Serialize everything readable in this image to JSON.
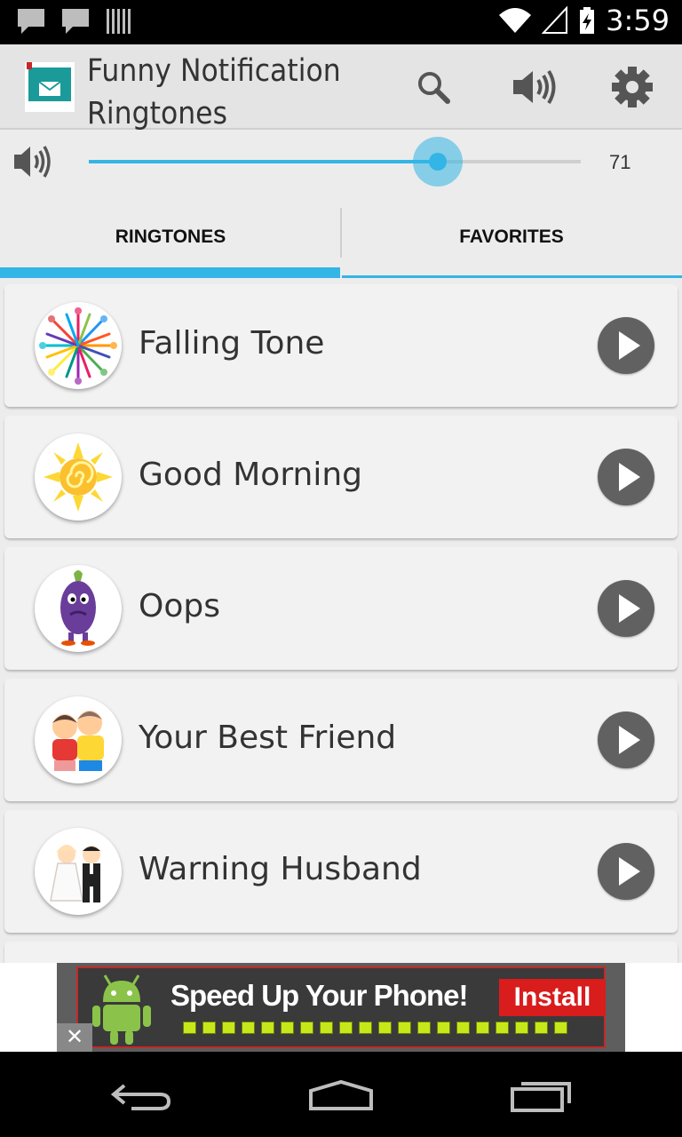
{
  "status_bar": {
    "time": "3:59",
    "notification_icons": [
      "chat-bubble-icon",
      "chat-bubble-icon",
      "barcode-icon"
    ],
    "system_icons": [
      "wifi-icon",
      "cell-signal-icon",
      "battery-charging-icon"
    ]
  },
  "action_bar": {
    "title": "Funny Notification Ringtones",
    "actions": [
      "search-icon",
      "volume-icon",
      "settings-icon"
    ]
  },
  "volume": {
    "value": "71",
    "level": 0.71,
    "accent_color": "#33b5e5"
  },
  "tabs": [
    {
      "label": "RINGTONES",
      "selected": true
    },
    {
      "label": "FAVORITES",
      "selected": false
    }
  ],
  "ringtones": [
    {
      "name": "Falling Tone",
      "thumbnail": "confetti-burst-image"
    },
    {
      "name": "Good Morning",
      "thumbnail": "sun-image"
    },
    {
      "name": "Oops",
      "thumbnail": "eggplant-character-image"
    },
    {
      "name": "Your Best Friend",
      "thumbnail": "kids-hugging-image"
    },
    {
      "name": "Warning Husband",
      "thumbnail": "bride-and-groom-image"
    }
  ],
  "ad": {
    "headline": "Speed Up Your Phone!",
    "cta": "Install",
    "close": "✕"
  },
  "nav_bar": [
    "back-icon",
    "home-icon",
    "recent-apps-icon"
  ]
}
